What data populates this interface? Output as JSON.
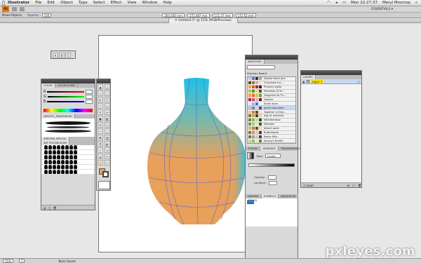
{
  "menubar": {
    "app": "Illustrator",
    "items": [
      "File",
      "Edit",
      "Object",
      "Type",
      "Select",
      "Effect",
      "View",
      "Window",
      "Help"
    ],
    "clock": "Mon 22:27:37",
    "user": "Meryl Moscrop"
  },
  "appbar": {
    "logo": "Ai",
    "workspace": "ESSENTIALS ▾"
  },
  "control": {
    "selection": "Mixed Objects",
    "opacity_label": "Opacity:",
    "opacity": "100",
    "x": "264.456 mm",
    "y": "172.487 mm",
    "w": "111.57 mm",
    "h": "172.63 mm"
  },
  "document": {
    "tab": "Untitled-1* @ 15% (RGB/Preview)"
  },
  "status": {
    "zoom": "15%",
    "page": "1",
    "tool": "None Saved"
  },
  "color_panel": {
    "tab1": "COLOR",
    "tab2": "COLOR GUIDE",
    "r": "R",
    "g": "G",
    "b": "B"
  },
  "brush_panel": {
    "title": "ARTISTIC_PAINTBRUSH",
    "title2": "ARROWS_SPECIAL",
    "title3": "ART PEN BRUSHES"
  },
  "swatches": {
    "title": "SWATCHES",
    "library": "Stephen Board",
    "rows": [
      "Sabine black gra...",
      "Chocolate ice...",
      "Phoenix lights",
      "Meadows of th...",
      "Tangerine to Th...",
      "Dahlias",
      "Arctic stars",
      "pearl mountains",
      "Together in Eter...",
      "Age of mankind",
      "Wild Bamboo",
      "Meadow",
      "desert paint",
      "Butterwood",
      "Rocky Hills",
      "Spring's Breath"
    ]
  },
  "gradient_panel": {
    "tabs": [
      "STROKE",
      "GRADIENT",
      "TRANSPARENCY"
    ],
    "type_label": "Type:",
    "type": "Linear",
    "opacity_label": "Opacity:",
    "location_label": "Location:"
  },
  "symbols_panel": {
    "tabs": [
      "GRAPHIC STYLES",
      "SYMBOLS",
      "NAVIGATOR"
    ]
  },
  "layers": {
    "title": "LAYERS",
    "layer_name": "Layer 1",
    "footer": "1 Layer"
  },
  "watermark": "pxleyes.com",
  "colors": {
    "accent_orange": "#E8A05A",
    "accent_cyan": "#1EC2E6",
    "mesh_line": "#5A6BC8"
  }
}
